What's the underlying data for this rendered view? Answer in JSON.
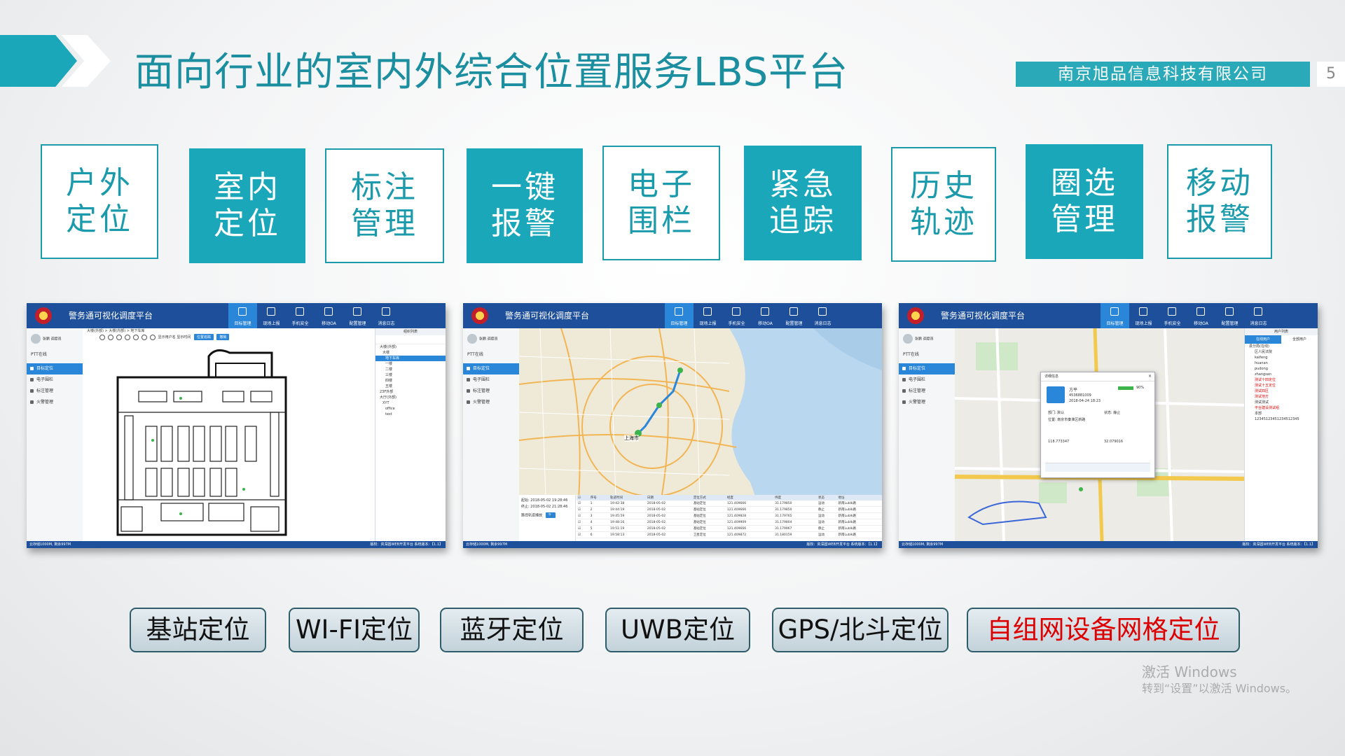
{
  "header": {
    "title": "面向行业的室内外综合位置服务LBS平台",
    "company": "南京旭品信息科技有限公司",
    "page_number": "5"
  },
  "features": [
    {
      "label": "户外定位",
      "style": "outline"
    },
    {
      "label": "室内定位",
      "style": "filled"
    },
    {
      "label": "标注管理",
      "style": "outline"
    },
    {
      "label": "一键报警",
      "style": "filled"
    },
    {
      "label": "电子围栏",
      "style": "outline"
    },
    {
      "label": "紧急追踪",
      "style": "filled"
    },
    {
      "label": "历史轨迹",
      "style": "outline"
    },
    {
      "label": "圈选管理",
      "style": "filled"
    },
    {
      "label": "移动报警",
      "style": "outline"
    }
  ],
  "app": {
    "title": "警务通可视化调度平台",
    "nav": [
      "目标管理",
      "现场上报",
      "手机安全",
      "移动OA",
      "配置管理",
      "消息日志"
    ],
    "user": "张鹏 调度员",
    "ptt": "PTT在线",
    "menu": [
      "目标定位",
      "电子围栏",
      "标注管理",
      "火警管理"
    ],
    "status_left": "云存储1000M, 剩余997M",
    "status_right": "版权：资深圆WEB开发平台 系统版本：【1.1】"
  },
  "screenshot1": {
    "breadcrumb": "大楼(外部) > 大楼(内部) > 地下车库",
    "check1": "显示用户名",
    "check2": "显示时间",
    "btn1": "位置追踪",
    "btn2": "撤销",
    "tree_head": "组织列表",
    "tree": [
      "大楼(外部)",
      "大楼",
      "地下车库",
      "一楼",
      "二楼",
      "三楼",
      "四楼",
      "五楼",
      "23F外部",
      "大厅(外部)",
      "XYT",
      "office",
      "test"
    ]
  },
  "screenshot2": {
    "date_start_label": "起始:",
    "date_start": "2018-05-02 19:28:46",
    "date_end_label": "终止:",
    "date_end": "2018-05-02 21:28:46",
    "track_label": "路径轨迹播放",
    "columns": [
      "序号",
      "轨迹时间",
      "日期",
      "定位方式",
      "经度",
      "纬度",
      "状态",
      "地址"
    ],
    "rows": [
      [
        "1",
        "19:42:38",
        "2018-05-02",
        "基站定位",
        "121.409666",
        "31.179850",
        "运动",
        "新南Lublk路"
      ],
      [
        "2",
        "19:44:19",
        "2018-05-02",
        "基站定位",
        "121.409666",
        "31.179850",
        "静止",
        "新南Lublk路"
      ],
      [
        "3",
        "19:45:59",
        "2018-05-02",
        "基站定位",
        "121.409828",
        "31.179765",
        "运动",
        "新南Lublk路"
      ],
      [
        "4",
        "19:48:16",
        "2018-05-02",
        "基站定位",
        "121.409909",
        "31.179804",
        "运动",
        "新南Lublk路"
      ],
      [
        "5",
        "19:51:19",
        "2018-05-02",
        "基站定位",
        "121.409666",
        "31.179967",
        "静止",
        "新南Lublk路"
      ],
      [
        "6",
        "19:58:13",
        "2018-05-02",
        "卫星定位",
        "121.409872",
        "31.180159",
        "运动",
        "新南Lublk路"
      ]
    ],
    "city_label": "上海市"
  },
  "screenshot3": {
    "popup_title": "详细信息",
    "name": "方平",
    "battery": "90%",
    "phone": "4536881009",
    "time": "2018-04-24 18:23",
    "unit_label": "部门: 默认",
    "status_label": "状态: 静止",
    "location": "位置: 南京市秦淮区新路",
    "lat": "32.079016",
    "lng": "118.773347",
    "tree_tabs": [
      "在线用户",
      "全部用户"
    ],
    "tree_head": "用户列表",
    "tree": [
      "县分局(在线)",
      "区人民法院",
      "kaifeng",
      "huanan",
      "pudong",
      "zhangsan",
      "测试十四定位",
      "测试十五定位",
      "测试四区",
      "测试地方",
      "测试测试",
      "平台建设测试组",
      "本部",
      "12345123451234512345"
    ]
  },
  "tech_buttons": [
    "基站定位",
    "WI-FI定位",
    "蓝牙定位",
    "UWB定位",
    "GPS/北斗定位",
    "自组网设备网格定位"
  ],
  "watermark": {
    "line1": "激活 Windows",
    "line2": "转到“设置”以激活 Windows。"
  },
  "colors": {
    "accent": "#1aa7b9",
    "title": "#1b8e9f",
    "app_blue": "#1d4f9a",
    "red_text": "#dd0000"
  }
}
